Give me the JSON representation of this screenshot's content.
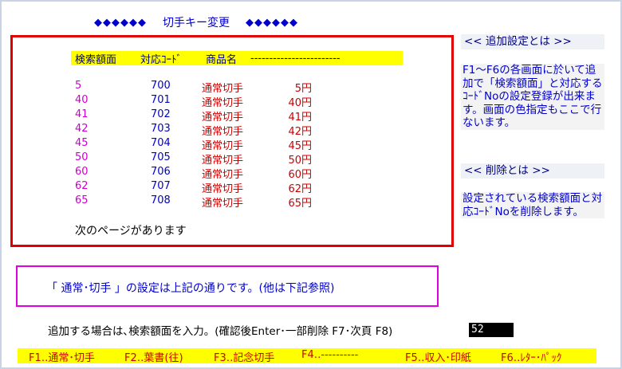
{
  "title": {
    "decor_left": "◆◆◆◆◆◆",
    "text": "切手キー変更",
    "decor_right": "◆◆◆◆◆◆"
  },
  "table": {
    "headers": {
      "amount": "検索額面",
      "code": "対応ｺｰﾄﾞ",
      "name": "商品名",
      "dashes": "------------------------"
    },
    "rows": [
      {
        "amount": "5",
        "code": "700",
        "name": "通常切手",
        "price": "5円"
      },
      {
        "amount": "40",
        "code": "701",
        "name": "通常切手",
        "price": "40円"
      },
      {
        "amount": "41",
        "code": "702",
        "name": "通常切手",
        "price": "41円"
      },
      {
        "amount": "42",
        "code": "703",
        "name": "通常切手",
        "price": "42円"
      },
      {
        "amount": "45",
        "code": "704",
        "name": "通常切手",
        "price": "45円"
      },
      {
        "amount": "50",
        "code": "705",
        "name": "通常切手",
        "price": "50円"
      },
      {
        "amount": "60",
        "code": "706",
        "name": "通常切手",
        "price": "60円"
      },
      {
        "amount": "62",
        "code": "707",
        "name": "通常切手",
        "price": "62円"
      },
      {
        "amount": "65",
        "code": "708",
        "name": "通常切手",
        "price": "65円"
      }
    ],
    "next_page": "次のページがあります"
  },
  "side": {
    "add_heading": "<< 追加設定とは >>",
    "add_text": "F1～F6の各画面に於いて追加で「検索額面」と対応するｺｰﾄﾞNoの設定登録が出来ます。画面の色指定もここで行ないます。",
    "delete_heading": "<< 削除とは >>",
    "delete_text": "設定されている検索額面と対応ｺｰﾄﾞNoを削除します。"
  },
  "message": "「 通常･切手 」の設定は上記の通りです。(他は下記参照)",
  "prompt": "追加する場合は､検索額面を入力。(確認後Enter･一部削除 F7･次頁 F8)",
  "input_value": "52",
  "fkeys": [
    "F1‥通常･切手",
    "F2‥葉書(往)",
    "F3‥記念切手",
    "F4‥----------",
    "F5‥収入･印紙",
    "F6‥ﾚﾀｰ･ﾊﾟｯｸ"
  ],
  "colors": {
    "border_red": "#e00000",
    "border_magenta": "#e000e0",
    "header_bg": "#ffff00",
    "text_blue": "#0000cc",
    "text_magenta": "#cc00cc",
    "text_red": "#cc0000"
  }
}
